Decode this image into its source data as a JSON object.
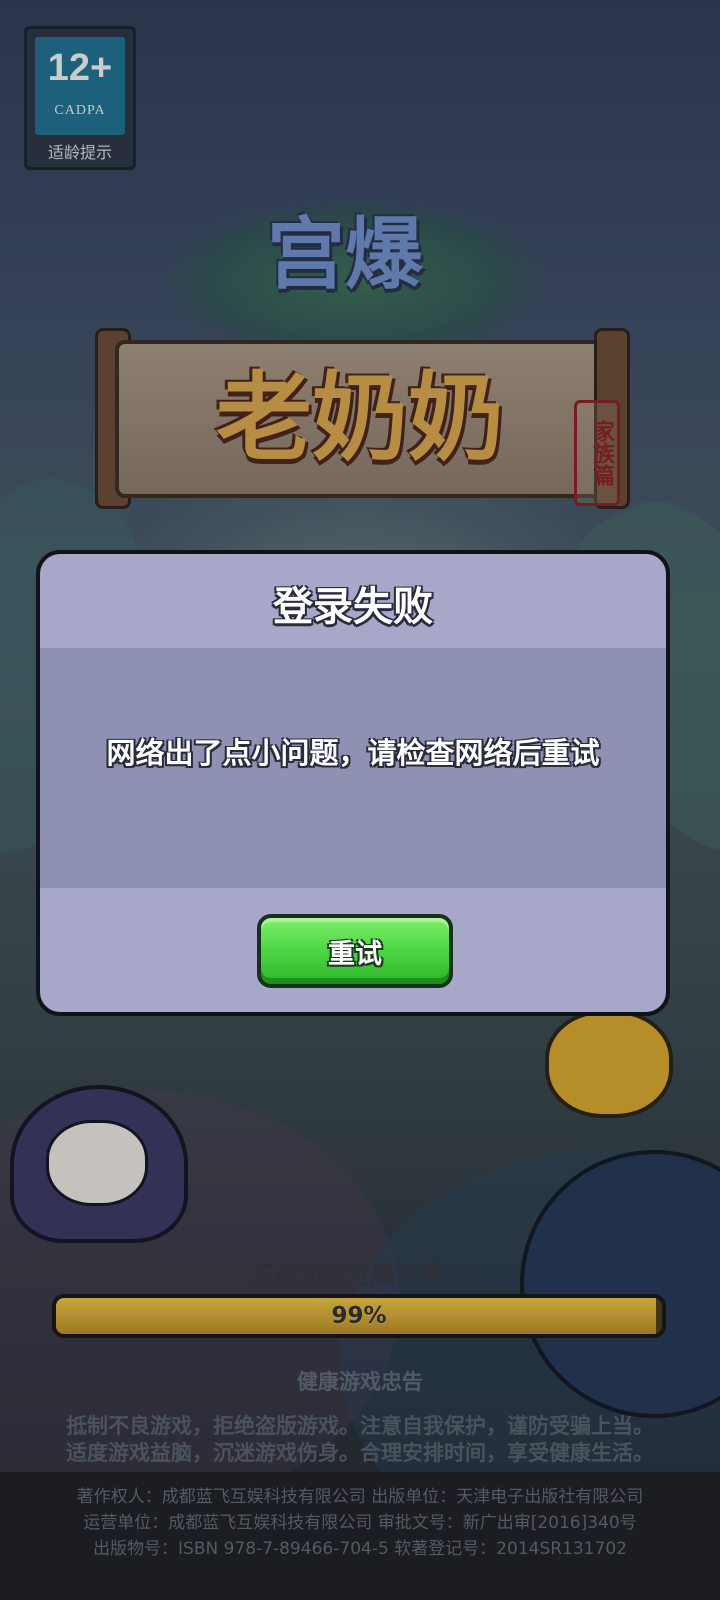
{
  "age_rating": {
    "number": "12+",
    "org": "CADPA",
    "tip": "适龄提示"
  },
  "logo": {
    "line1": "宫爆",
    "line2": "老奶奶",
    "seal": "家族篇"
  },
  "dialog": {
    "title": "登录失败",
    "message": "网络出了点小问题，请检查网络后重试",
    "retry_label": "重试"
  },
  "loading": {
    "text": "正在加载宫爆世界...",
    "progress_percent": 99,
    "progress_label": "99%"
  },
  "health_notice": {
    "title": "健康游戏忠告",
    "line1": "抵制不良游戏，拒绝盗版游戏。注意自我保护，谨防受骗上当。",
    "line2": "适度游戏益脑，沉迷游戏伤身。合理安排时间，享受健康生活。"
  },
  "footer": {
    "line1": "著作权人：成都蓝飞互娱科技有限公司  出版单位：天津电子出版社有限公司",
    "line2": "运营单位：成都蓝飞互娱科技有限公司  审批文号：新广出审[2016]340号",
    "line3": "出版物号：ISBN 978-7-89466-704-5  软著登记号：2014SR131702"
  },
  "colors": {
    "dialog_bg": "#a7a8c9",
    "dialog_body_bg": "#8f91b3",
    "retry_button": "#48d23f",
    "progress_fill": "#c9a33f"
  }
}
